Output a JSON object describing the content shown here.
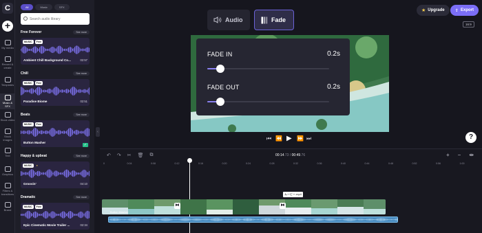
{
  "sidebar": {
    "logo": "C",
    "add_label": "+",
    "items": [
      {
        "label": "My media",
        "icon": "folder-icon"
      },
      {
        "label": "Record & create",
        "icon": "camera-icon"
      },
      {
        "label": "Templates",
        "icon": "templates-icon"
      },
      {
        "label": "Music & SFX",
        "icon": "music-note-icon",
        "active": true
      },
      {
        "label": "Stock video",
        "icon": "film-icon"
      },
      {
        "label": "Stock images",
        "icon": "image-icon"
      },
      {
        "label": "Text",
        "icon": "text-icon"
      },
      {
        "label": "Graphics",
        "icon": "shapes-icon"
      },
      {
        "label": "Filters & transitions",
        "icon": "filters-icon"
      },
      {
        "label": "Brand",
        "icon": "brand-icon"
      }
    ]
  },
  "library": {
    "tabs": [
      "All",
      "Music",
      "SFX"
    ],
    "search_placeholder": "Search audio library",
    "see_more": "See more",
    "sections": [
      {
        "title": "Free Forever",
        "track": "Ambient Chill Background Co...",
        "duration": "02:57",
        "badges": [
          "MUSIC",
          "Free"
        ]
      },
      {
        "title": "Chill",
        "track": "Paradise Biome",
        "duration": "02:51",
        "badges": [
          "MUSIC",
          "Free"
        ]
      },
      {
        "title": "Beats",
        "track": "Button Masher",
        "duration": "",
        "badges": [
          "MUSIC",
          "Free"
        ]
      },
      {
        "title": "Happy & upbeat",
        "track": "Groovin'",
        "duration": "04:10",
        "badges": [
          "MUSIC"
        ]
      },
      {
        "title": "Dramatic",
        "track": "Epic Cinematic Movie Trailer ...",
        "duration": "02:34",
        "badges": [
          "MUSIC",
          "Free"
        ]
      }
    ]
  },
  "header": {
    "upgrade_label": "Upgrade",
    "export_label": "Export",
    "aspect_ratio": "16:9"
  },
  "panel_tabs": {
    "audio_label": "Audio",
    "fade_label": "Fade"
  },
  "fade": {
    "fade_in_label": "FADE IN",
    "fade_in_value": "0.2s",
    "fade_in_level": 0.11,
    "fade_out_label": "FADE OUT",
    "fade_out_value": "0.2s",
    "fade_out_level": 0.11
  },
  "playback": {
    "current_time": "00:14",
    "current_frames": ".73",
    "separator": "/",
    "total_time": "00:49",
    "total_frames": ".76",
    "help_label": "?"
  },
  "timeline": {
    "ticks": [
      "0",
      "0:04",
      "0:08",
      "0:12",
      "0:16",
      "0:20",
      "0:24",
      "0:28",
      "0:32",
      "0:36",
      "0:40",
      "0:44",
      "0:48",
      "0:52",
      "0:56",
      "1:00"
    ],
    "clip_tag": "ムービー.mp4",
    "audio_track_label": "Button Masher"
  },
  "colors": {
    "accent": "#7b6ef6",
    "background": "#16161e",
    "audio_track": "#4a8cc0"
  }
}
